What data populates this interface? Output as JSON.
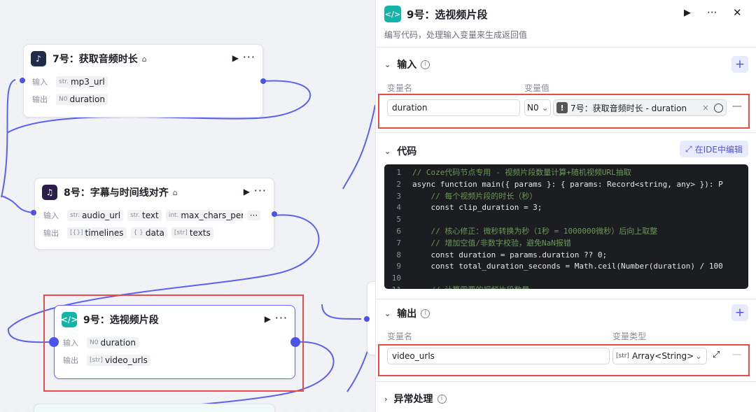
{
  "canvas": {
    "nodes": [
      {
        "id": "n7",
        "title": "7号：获取音频时长",
        "inputs": [
          {
            "t": "str.",
            "name": "mp3_url"
          }
        ],
        "outputs": [
          {
            "t": "N0",
            "name": "duration"
          }
        ]
      },
      {
        "id": "n8",
        "title": "8号：字幕与时间线对齐",
        "inputs": [
          {
            "t": "str.",
            "name": "audio_url"
          },
          {
            "t": "str.",
            "name": "text"
          },
          {
            "t": "int.",
            "name": "max_chars_per_l"
          }
        ],
        "outputs": [
          {
            "t": "[{}]",
            "name": "timelines"
          },
          {
            "t": "{ }",
            "name": "data"
          },
          {
            "t": "[str]",
            "name": "texts"
          }
        ]
      },
      {
        "id": "n9",
        "title": "9号：选视频片段",
        "inputs": [
          {
            "t": "N0",
            "name": "duration"
          }
        ],
        "outputs": [
          {
            "t": "[str]",
            "name": "video_urls"
          }
        ]
      }
    ],
    "row_labels": {
      "input": "输入",
      "output": "输出"
    }
  },
  "panel": {
    "title": "9号：选视频片段",
    "description": "编写代码，处理输入变量来生成返回值",
    "input": {
      "heading": "输入",
      "col_name": "变量名",
      "col_value": "变量值",
      "var_name": "duration",
      "type_select": "N0",
      "ref_value": "7号：获取音频时长 - duration"
    },
    "code": {
      "heading": "代码",
      "ide_button": "在IDE中编辑",
      "lines": [
        {
          "n": "1",
          "text": "// Coze代码节点专用 - 视频片段数量计算+随机视频URL抽取",
          "comment": true
        },
        {
          "n": "2",
          "text": "async function main({ params }: { params: Record<string, any> }): P",
          "comment": false
        },
        {
          "n": "3",
          "text": "    // 每个视频片段的时长（秒）",
          "comment": true
        },
        {
          "n": "4",
          "text": "    const clip_duration = 3;",
          "comment": false
        },
        {
          "n": "5",
          "text": "",
          "comment": false
        },
        {
          "n": "6",
          "text": "    // 核心修正：微秒转换为秒（1秒 = 1000000微秒）后向上取整",
          "comment": true
        },
        {
          "n": "7",
          "text": "    // 增加空值/非数字校验，避免NaN报错",
          "comment": true
        },
        {
          "n": "8",
          "text": "    const duration = params.duration ?? 0;",
          "comment": false
        },
        {
          "n": "9",
          "text": "    const total_duration_seconds = Math.ceil(Number(duration) / 100",
          "comment": false
        },
        {
          "n": "10",
          "text": "",
          "comment": false
        },
        {
          "n": "11",
          "text": "    // 计算需要的视频片段数量",
          "comment": true
        }
      ]
    },
    "output": {
      "heading": "输出",
      "col_name": "变量名",
      "col_type": "变量类型",
      "var_name": "video_urls",
      "var_type": "Array<String>",
      "type_prefix": "[str]"
    },
    "error": {
      "heading": "异常处理"
    }
  }
}
